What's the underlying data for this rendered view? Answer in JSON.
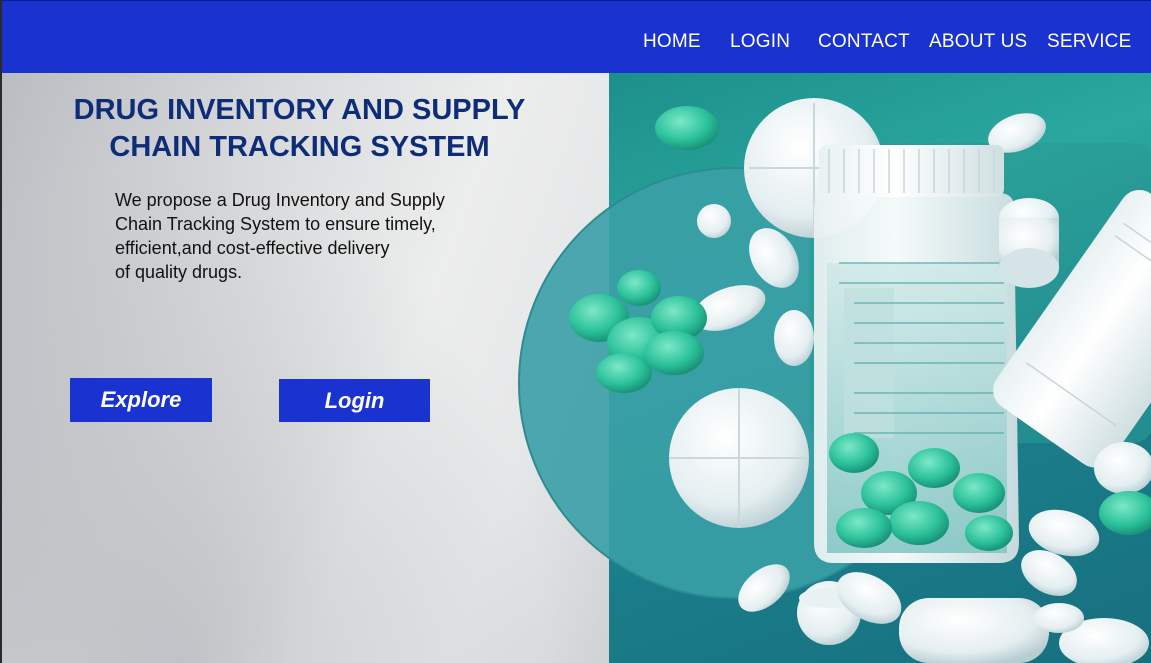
{
  "nav": {
    "items": [
      {
        "label": "HOME"
      },
      {
        "label": "LOGIN"
      },
      {
        "label": "CONTACT"
      },
      {
        "label": "ABOUT US"
      },
      {
        "label": "SERVICE"
      }
    ]
  },
  "hero": {
    "title": "DRUG INVENTORY AND SUPPLY CHAIN TRACKING SYSTEM",
    "description": "We propose a Drug Inventory and Supply\nChain Tracking System to ensure timely,\nefficient,and cost-effective delivery\nof quality drugs.",
    "explore_label": "Explore",
    "login_label": "Login"
  },
  "colors": {
    "nav_bg": "#1a32d0",
    "title": "#0d2d78",
    "button_bg": "#1a32d0",
    "teal": "#1d8f8b"
  }
}
